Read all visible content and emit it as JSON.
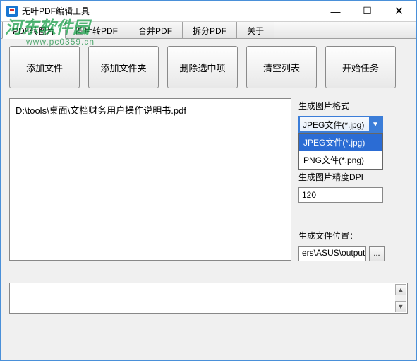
{
  "window": {
    "title": "无叶PDF编辑工具",
    "icon_label": "PDF"
  },
  "win_controls": {
    "minimize": "—",
    "maximize": "☐",
    "close": "✕"
  },
  "tabs": [
    {
      "label": "PDF转图片",
      "active": true
    },
    {
      "label": "图片转PDF",
      "active": false
    },
    {
      "label": "合并PDF",
      "active": false
    },
    {
      "label": "拆分PDF",
      "active": false
    },
    {
      "label": "关于",
      "active": false
    }
  ],
  "actions": {
    "add_file": "添加文件",
    "add_folder": "添加文件夹",
    "delete_selected": "删除选中项",
    "clear_list": "清空列表",
    "start_task": "开始任务"
  },
  "file_list": {
    "items": [
      "D:\\tools\\桌面\\文档财务用户操作说明书.pdf"
    ]
  },
  "right": {
    "format_label": "生成图片格式",
    "format_selected": "JPEG文件(*.jpg)",
    "format_options": [
      {
        "label": "JPEG文件(*.jpg)",
        "selected": true
      },
      {
        "label": "PNG文件(*.png)",
        "selected": false
      }
    ],
    "dpi_label": "生成图片精度DPI",
    "dpi_value": "120",
    "out_label": "生成文件位置：",
    "out_path": "ers\\ASUS\\output",
    "browse": "..."
  },
  "dropdown_arrow": "▼",
  "scroll": {
    "up": "▲",
    "down": "▼"
  },
  "watermark": {
    "line1": "河东软件园",
    "line2": "www.pc0359.cn"
  }
}
